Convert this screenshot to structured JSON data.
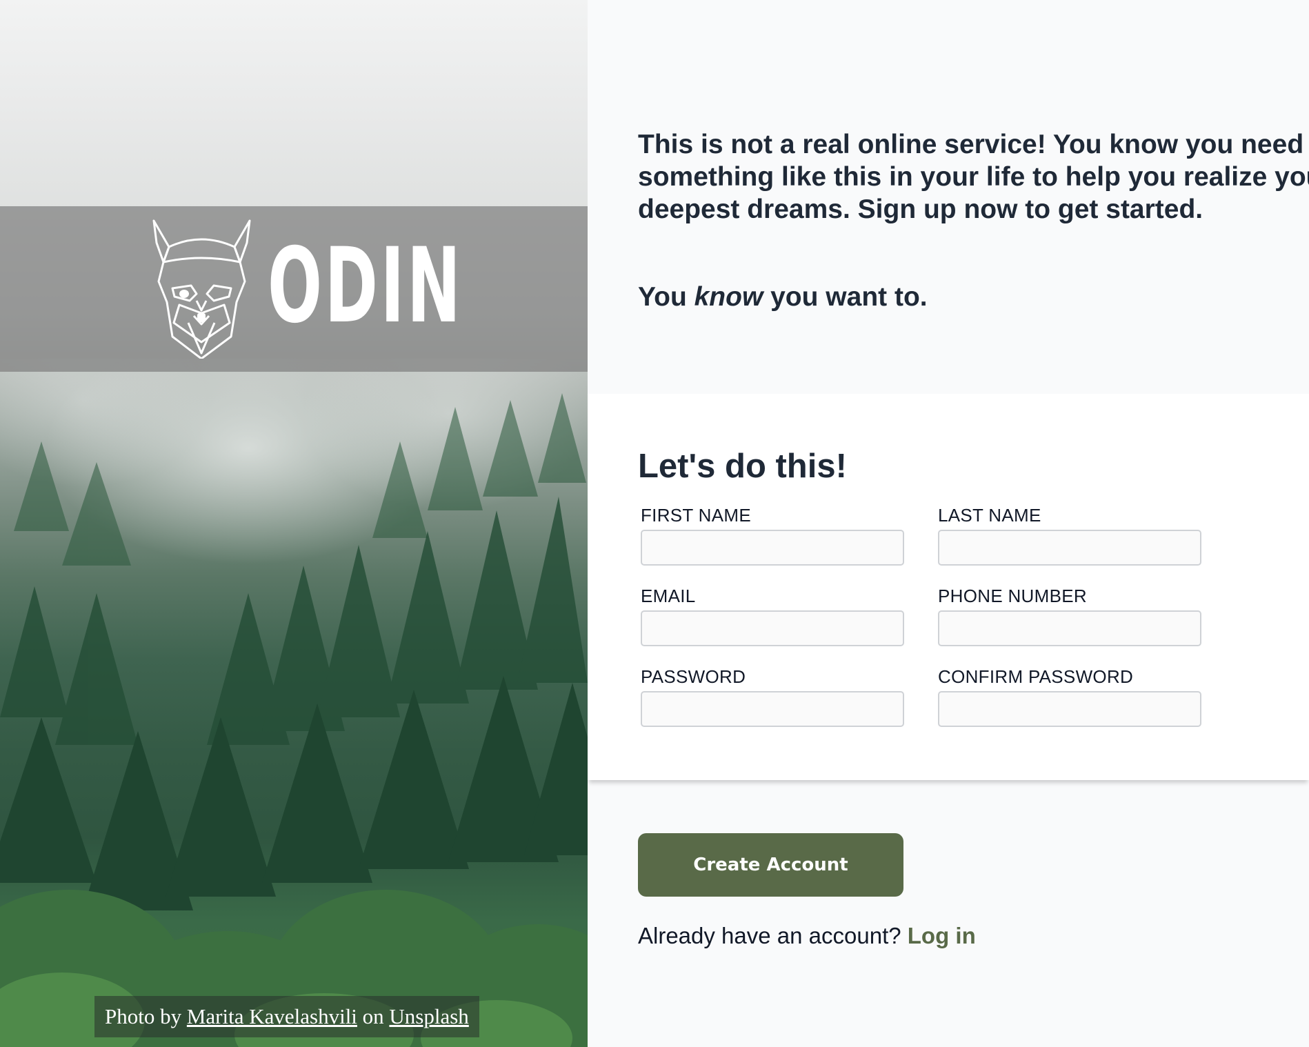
{
  "hero": {
    "brand_name": "ODIN",
    "credit": {
      "prefix": "Photo by ",
      "author": "Marita Kavelashvili",
      "middle": " on ",
      "site": "Unsplash"
    }
  },
  "intro": {
    "paragraph": "This is not a real online service! You know you need something like this in your life to help you realize your deepest dreams. Sign up now to get started.",
    "tagline_before": "You ",
    "tagline_emphasis": "know",
    "tagline_after": " you want to."
  },
  "form": {
    "title": "Let's do this!",
    "fields": [
      {
        "label": "FIRST NAME",
        "value": "",
        "placeholder": ""
      },
      {
        "label": "LAST NAME",
        "value": "",
        "placeholder": ""
      },
      {
        "label": "EMAIL",
        "value": "",
        "placeholder": ""
      },
      {
        "label": "PHONE NUMBER",
        "value": "",
        "placeholder": ""
      },
      {
        "label": "PASSWORD",
        "value": "",
        "placeholder": ""
      },
      {
        "label": "CONFIRM PASSWORD",
        "value": "",
        "placeholder": ""
      }
    ]
  },
  "actions": {
    "create_label": "Create Account",
    "login_prompt": "Already have an account? ",
    "login_link": "Log in"
  },
  "colors": {
    "accent": "#596a48",
    "text": "#1f2937",
    "background": "#f9fafb",
    "card": "#ffffff"
  },
  "icons": {
    "logo": "viking-helmet-icon"
  }
}
